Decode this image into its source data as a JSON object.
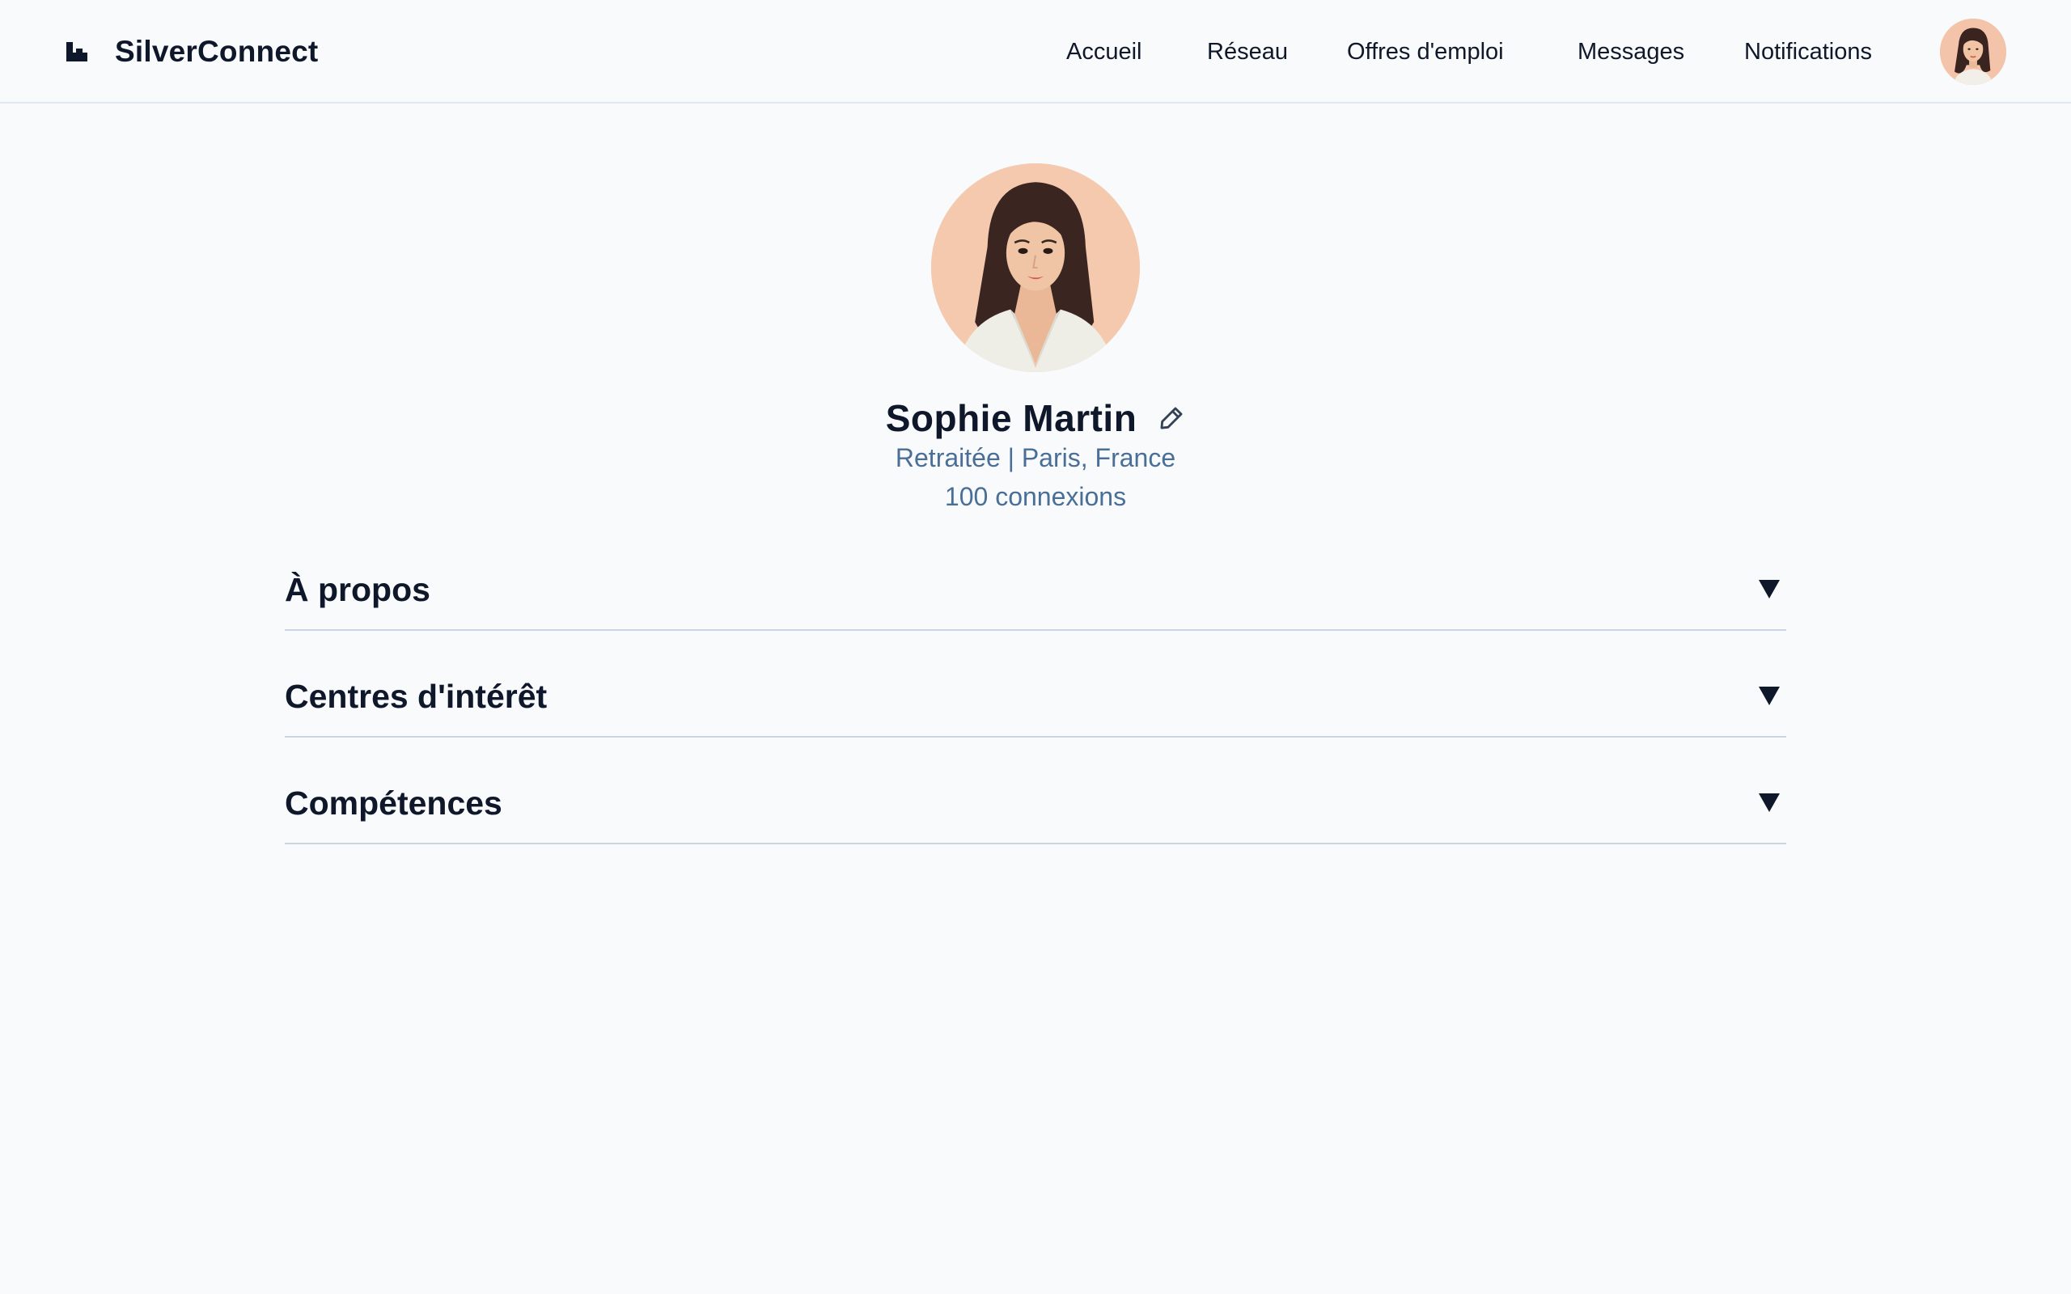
{
  "brand": {
    "name": "SilverConnect"
  },
  "nav": {
    "items": [
      {
        "label": "Accueil"
      },
      {
        "label": "Réseau"
      },
      {
        "label": "Offres d'emploi"
      },
      {
        "label": "Messages"
      },
      {
        "label": "Notifications"
      }
    ]
  },
  "profile": {
    "name": "Sophie Martin",
    "headline": "Retraitée | Paris, France",
    "connections": "100 connexions"
  },
  "sections": [
    {
      "title": "À propos"
    },
    {
      "title": "Centres d'intérêt"
    },
    {
      "title": "Compétences"
    }
  ],
  "colors": {
    "background": "#f8fafc",
    "text": "#0f172a",
    "accent": "#4a6f96",
    "divider": "#cbd5e1"
  },
  "icons": {
    "logo": "brand-logo-icon",
    "edit": "pencil-icon",
    "caret": "caret-down-icon"
  }
}
